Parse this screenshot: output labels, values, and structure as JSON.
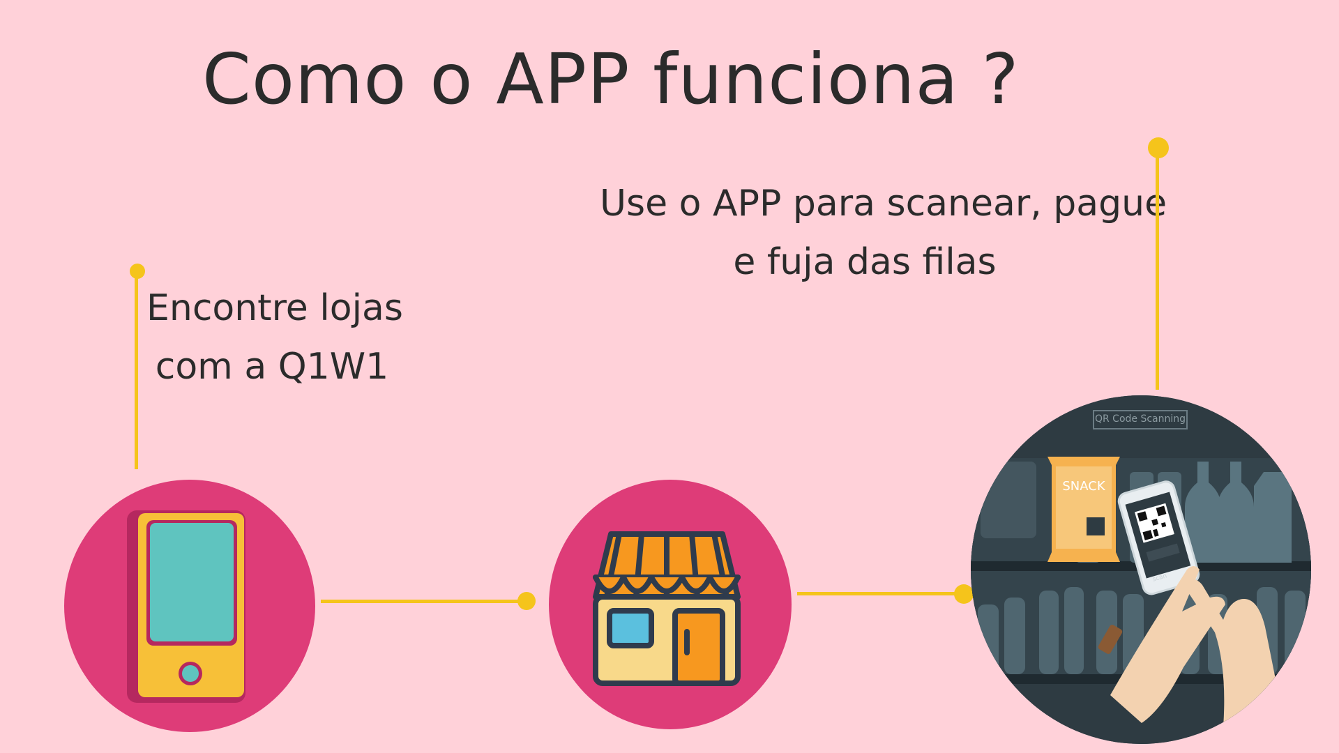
{
  "title": "Como o APP funciona ?",
  "steps": [
    {
      "lines": [
        "Encontre lojas",
        "com a Q1W1"
      ],
      "icon": "smartphone-icon"
    },
    {
      "lines": [],
      "icon": "store-icon"
    },
    {
      "lines": [
        "Use o APP para scanear, pague",
        "e fuja das filas"
      ],
      "icon": "qr-scan-illustration"
    }
  ],
  "scan_scene": {
    "sign": "QR Code Scanning",
    "snack": "SNACK",
    "phone_button": "scan"
  },
  "colors": {
    "background": "#ffd1d9",
    "accent": "#f5c41b",
    "circle": "#de3c78",
    "text": "#2b2b2b"
  }
}
